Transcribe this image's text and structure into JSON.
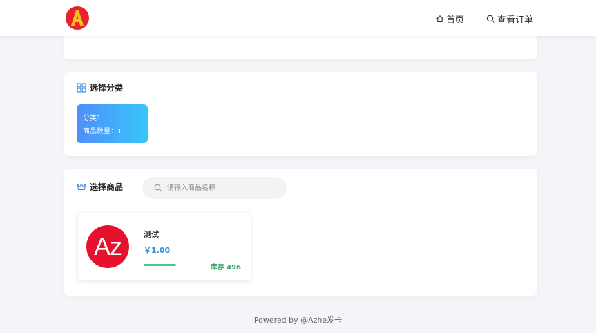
{
  "nav": {
    "logo_letter": "A",
    "home_label": "首页",
    "orders_label": "查看订单"
  },
  "categories": {
    "title": "选择分类",
    "items": [
      {
        "name": "分类1",
        "count_label": "商品数量：1"
      }
    ]
  },
  "goods": {
    "title": "选择商品",
    "search_placeholder": "请输入商品名称",
    "items": [
      {
        "image_text": "Az",
        "name": "测试",
        "price": "￥1.00",
        "stock_label": "库存 496",
        "stock_level": 1.0
      }
    ]
  },
  "footer": {
    "text": "Powered by @Azhe发卡"
  },
  "colors": {
    "accent": "#3c8dd9",
    "category_gradient_start": "#4f8ff7",
    "category_gradient_end": "#37c6fb",
    "stock_green": "#4cc48a",
    "product_image_red": "#e8112d",
    "logo_red": "#e8232d",
    "logo_yellow": "#f7c21b"
  },
  "icons": {
    "home": "home-icon",
    "orders": "search-icon",
    "category": "grid-icon",
    "goods": "crown-icon",
    "search": "search-icon"
  }
}
